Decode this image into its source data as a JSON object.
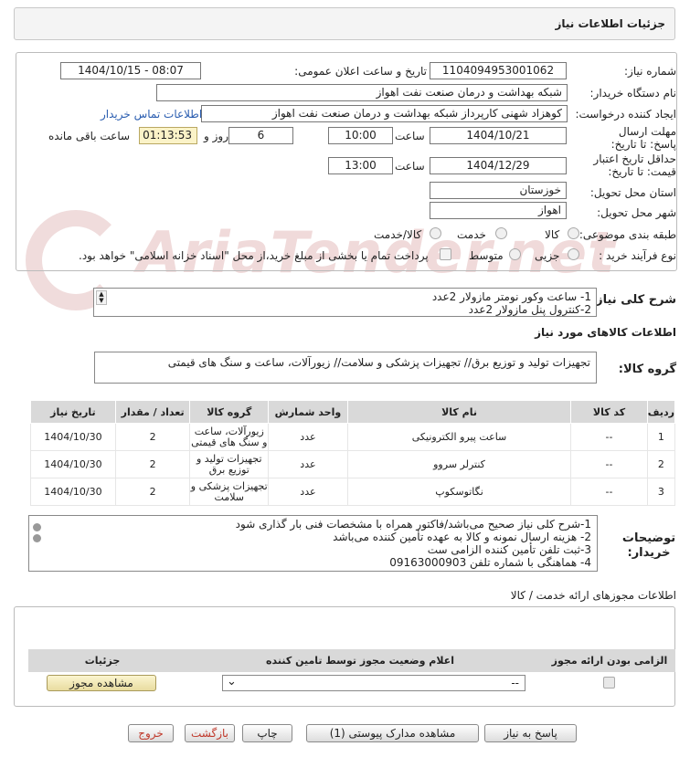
{
  "header": {
    "title": "جزئیات اطلاعات نیاز"
  },
  "form": {
    "need_number_label": "شماره نیاز:",
    "need_number": "1104094953001062",
    "announce_label": "تاریخ و ساعت اعلان عمومی:",
    "announce_value": "1404/10/15 - 08:07",
    "buyer_label": "نام دستگاه خریدار:",
    "buyer_value": "شبکه بهداشت و درمان صنعت نفت اهواز",
    "creator_label": "ایجاد کننده درخواست:",
    "creator_value": "کوهزاد شهنی کارپرداز شبکه بهداشت و درمان صنعت نفت اهواز",
    "contact_link": "اطلاعات تماس خریدار",
    "deadline_label": "مهلت ارسال پاسخ: تا تاریخ:",
    "deadline_date": "1404/10/21",
    "time_label": "ساعت",
    "deadline_time": "10:00",
    "days_value": "6",
    "days_label": "روز و",
    "remaining_time": "01:13:53",
    "remaining_label": "ساعت باقی مانده",
    "validity_label": "حداقل تاریخ اعتبار قیمت: تا تاریخ:",
    "validity_date": "1404/12/29",
    "validity_time": "13:00",
    "province_label": "استان محل تحویل:",
    "province_value": "خوزستان",
    "city_label": "شهر محل تحویل:",
    "city_value": "اهواز",
    "category_label": "طبقه بندی موضوعی:",
    "category_options": [
      "کالا",
      "خدمت",
      "کالا/خدمت"
    ],
    "process_label": "نوع فرآیند خرید :",
    "process_options": [
      "جزیی",
      "متوسط"
    ],
    "payment_note": "پرداخت تمام یا بخشی از مبلغ خرید،از محل \"اسناد خزانه اسلامی\" خواهد بود."
  },
  "summary": {
    "label": "شرح کلی نیاز:",
    "lines": [
      "1- ساعت وکور نومتر مازولار 2عدد",
      "2-کنترول پنل مازولار 2عدد"
    ]
  },
  "goods": {
    "section_title": "اطلاعات کالاهای مورد نیاز",
    "group_label": "گروه کالا:",
    "group_value": "تجهیزات تولید و توزیع برق// تجهیزات پزشکی و سلامت// زیورآلات، ساعت و سنگ های قیمتی",
    "columns": [
      "ردیف",
      "کد کالا",
      "نام کالا",
      "واحد شمارش",
      "گروه کالا",
      "تعداد / مقدار",
      "تاریخ نیاز"
    ],
    "rows": [
      {
        "idx": "1",
        "code": "--",
        "name": "ساعت پیرو الکترونیکی",
        "unit": "عدد",
        "group": "زیورآلات، ساعت و سنگ های قیمتی",
        "qty": "2",
        "date": "1404/10/30"
      },
      {
        "idx": "2",
        "code": "--",
        "name": "کنترلر سروو",
        "unit": "عدد",
        "group": "تجهیزات تولید و توزیع برق",
        "qty": "2",
        "date": "1404/10/30"
      },
      {
        "idx": "3",
        "code": "--",
        "name": "نگاتوسکوپ",
        "unit": "عدد",
        "group": "تجهیزات پزشکی و سلامت",
        "qty": "2",
        "date": "1404/10/30"
      }
    ]
  },
  "buyer_notes": {
    "label": "توضیحات خریدار:",
    "lines": [
      "1-شرح کلی نیاز صحیح می‌باشد/فاکتور همراه با مشخصات فنی بار گذاری شود",
      "2- هزینه ارسال نمونه و کالا به عهده تأمین کننده می‌باشد",
      "3-ثبت تلفن تأمین کننده الزامی ست",
      "4- هماهنگی با شماره تلفن 09163000903"
    ]
  },
  "permits": {
    "section_title": "اطلاعات مجوزهای ارائه خدمت / کالا",
    "columns": [
      "الزامی بودن ارائه مجوز",
      "اعلام وضعیت مجوز توسط تامین کننده",
      "جزئیات"
    ],
    "select_value": "--",
    "view_button": "مشاهده مجوز"
  },
  "actions": {
    "reply": "پاسخ به نیاز",
    "docs": "مشاهده مدارک پیوستی (1)",
    "print": "چاپ",
    "back": "بازگشت",
    "exit": "خروج"
  },
  "watermark": {
    "text": "AriaTender.net",
    "color": "#e8c8c8"
  }
}
